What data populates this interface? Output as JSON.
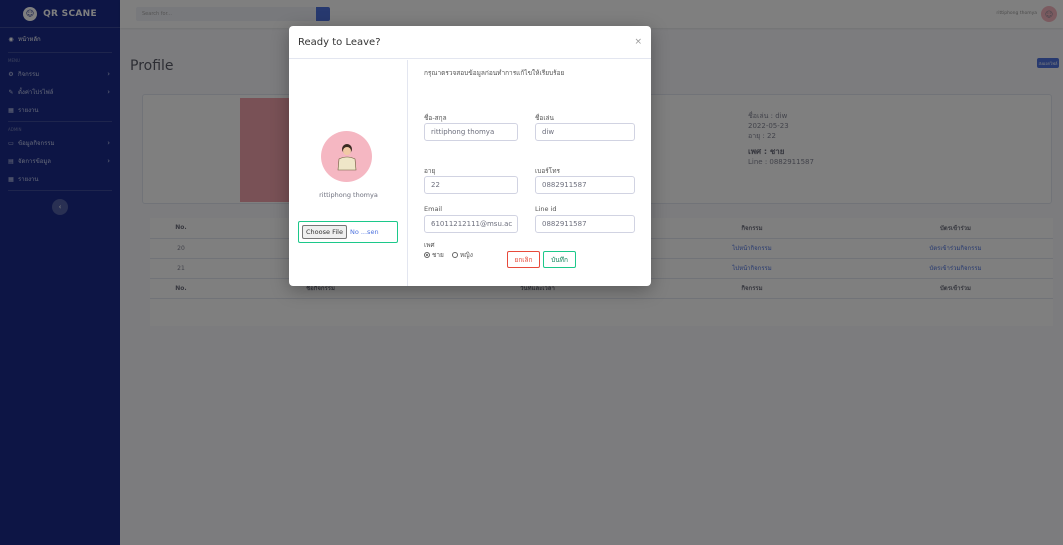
{
  "brand": {
    "name": "QR SCANE"
  },
  "sidebar": {
    "dashboard": "หน้าหลัก",
    "heading1": "MENU",
    "items1": [
      "กิจกรรม",
      "ตั้งค่าโปรไฟล์",
      "รายงาน"
    ],
    "heading2": "ADMIN",
    "items2": [
      "ข้อมูลกิจกรรม",
      "จัดการข้อมูล",
      "รายงาน"
    ]
  },
  "topbar": {
    "search_placeholder": "Search for...",
    "user_name": "rittiphong thomya"
  },
  "page": {
    "title": "Profile",
    "export": "ส่งออกไฟล์"
  },
  "profile_card": {
    "nickname": "ชื่อเล่น : diw",
    "date": "2022-05-23",
    "age": "อายุ : 22",
    "sex": "เพศ : ชาย",
    "line": "Line : 0882911587"
  },
  "table": {
    "headers": [
      "No.",
      "ชื่อกิจกรรม",
      "วันที่และเวลา",
      "กิจกรรม",
      "บัตรเข้าร่วม"
    ],
    "rows": [
      [
        "20",
        "",
        "",
        "ไปหน้ากิจกรรม",
        "บัตรเข้าร่วมกิจกรรม"
      ],
      [
        "21",
        "",
        "",
        "ไปหน้ากิจกรรม",
        "บัตรเข้าร่วมกิจกรรม"
      ]
    ]
  },
  "modal": {
    "title": "Ready to Leave?",
    "close": "×",
    "avatar_name": "rittiphong thomya",
    "file_button": "Choose File",
    "file_text": "No ...sen",
    "instruction": "กรุณาตรวจสอบข้อมูลก่อนทำการแก้ไขให้เรียบร้อย",
    "fields": {
      "fullname_label": "ชื่อ-สกุล",
      "fullname": "rittiphong thomya",
      "nickname_label": "ชื่อเล่น",
      "nickname": "diw",
      "age_label": "อายุ",
      "age": "22",
      "phone_label": "เบอร์โทร",
      "phone": "0882911587",
      "email_label": "Email",
      "email": "61011212111@msu.ac",
      "line_label": "Line id",
      "line": "0882911587",
      "sex_label": "เพศ",
      "sex_male": "ชาย",
      "sex_female": "หญิง"
    },
    "cancel": "ยกเลิก",
    "save": "บันทึก"
  }
}
